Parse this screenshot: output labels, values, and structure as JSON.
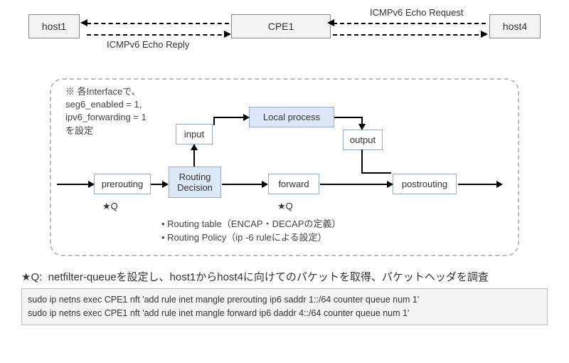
{
  "top": {
    "host1": "host1",
    "cpe1": "CPE1",
    "host4": "host4",
    "req_label": "ICMPv6 Echo Request",
    "rep_label": "ICMPv6 Echo Reply"
  },
  "panel": {
    "note_l1": "※ 各Interfaceで、",
    "note_l2": "seg6_enabled = 1,",
    "note_l3": "ipv6_forwarding = 1",
    "note_l4": "を設定",
    "prerouting": "prerouting",
    "routing_l1": "Routing",
    "routing_l2": "Decision",
    "input": "input",
    "local_process": "Local process",
    "output": "output",
    "forward": "forward",
    "postrouting": "postrouting",
    "starq": "★Q",
    "bullet1": "Routing table（ENCAP・DECAPの定義）",
    "bullet2": "Routing Policy（ip -6 ruleによる設定）"
  },
  "bottom": {
    "q_prefix": "★Q:",
    "q_text": "netfilter-queueを設定し、host1からhost4に向けてのパケットを取得、パケットヘッダを調査",
    "code_l1": "sudo ip netns exec CPE1 nft 'add rule inet mangle prerouting ip6 saddr 1::/64 counter queue num 1'",
    "code_l2": "sudo ip netns exec CPE1 nft 'add rule inet mangle forward ip6 daddr 4::/64 counter queue num 1'"
  }
}
